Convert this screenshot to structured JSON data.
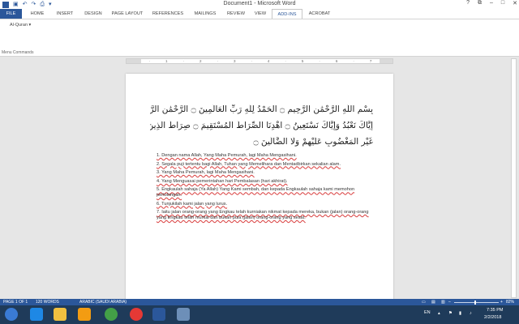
{
  "window": {
    "title": "Document1 - Microsoft Word",
    "qat": {
      "word_logo": "W",
      "save_icon": "floppy-icon",
      "undo_icon": "undo-icon",
      "redo_icon": "redo-icon",
      "print_icon": "print-icon",
      "more_icon": "dropdown-icon"
    },
    "controls": {
      "help": "?",
      "restore": "⧉",
      "minimize": "–",
      "maximize": "□",
      "close": "✕"
    }
  },
  "tabs": [
    {
      "label": "FILE"
    },
    {
      "label": "HOME"
    },
    {
      "label": "INSERT"
    },
    {
      "label": "DESIGN"
    },
    {
      "label": "PAGE LAYOUT"
    },
    {
      "label": "REFERENCES"
    },
    {
      "label": "MAILINGS"
    },
    {
      "label": "REVIEW"
    },
    {
      "label": "VIEW"
    },
    {
      "label": "ADD-INS"
    },
    {
      "label": "ACROBAT"
    }
  ],
  "active_tab": "ADD-INS",
  "ribbon": {
    "button_label": "Al-Quran ▾",
    "group_label": "Menu Commands"
  },
  "ruler": {
    "ticks": [
      "·",
      "1",
      "·",
      "2",
      "·",
      "3",
      "·",
      "4",
      "·",
      "5",
      "·",
      "6",
      "·",
      "7"
    ]
  },
  "document": {
    "arabic_lines": [
      "بِسْمِ اللَّهِ الرَّحْمَٰنِ الرَّحِيمِ ۝ الْحَمْدُ لِلَّهِ رَبِّ الْعَالَمِينَ ۝ الرَّحْمَٰنِ الرَّحِيمِ ۝ مَالِكِ يَوْمِ الدِّينِ",
      "إِيَّاكَ نَعْبُدُ وَإِيَّاكَ نَسْتَعِينُ ۝ اهْدِنَا الصِّرَاطَ الْمُسْتَقِيمَ ۝ صِرَاطَ الَّذِينَ أَنْعَمْتَ عَلَيْهِمْ",
      "غَيْرِ الْمَغْضُوبِ عَلَيْهِمْ وَلَا الضَّالِّينَ ۝"
    ],
    "verses": [
      "1. Dengan nama Allah, Yang Maha Pemurah, lagi Maha Mengasihani.",
      "2. Segala puji tertentu bagi Allah, Tuhan yang Memelihara dan Mentadbirkan sekalian alam.",
      "3. Yang Maha Pemurah, lagi Maha Mengasihani.",
      "4. Yang Menguasai pemerintahan hari Pembalasan (hari akhirat).",
      "5. Engkaulah sahaja (Ya Allah) Yang Kami sembah, dan kepada Engkaulah sahaja kami memohon pertolongan.",
      "6. Tunjukilah kami jalan yang lurus.",
      "7. Iaitu jalan orang-orang yang Engkau telah kurniakan nikmat kepada mereka, bukan (jalan) orang-orang yang Engkau telah murkai dan bukan pula (jalan) orang-orang yang sesat."
    ]
  },
  "statusbar": {
    "page": "PAGE 1 OF 1",
    "words": "120 WORDS",
    "language": "ARABIC (SAUDI ARABIA)",
    "zoom": "82%",
    "zoom_fraction": 0.45
  },
  "taskbar": {
    "icons": [
      {
        "name": "start-icon",
        "color": "#3a7bd5"
      },
      {
        "name": "ie-icon",
        "color": "#1e88e5"
      },
      {
        "name": "explorer-icon",
        "color": "#f0c040"
      },
      {
        "name": "media-player-icon",
        "color": "#f39c12"
      },
      {
        "name": "chrome-icon",
        "color": "#43a047"
      },
      {
        "name": "opera-icon",
        "color": "#e53935"
      },
      {
        "name": "word-taskbar-icon",
        "color": "#2b579a"
      },
      {
        "name": "app-taskbar-icon",
        "color": "#6d8fb8"
      }
    ],
    "lang": "EN",
    "time": "7:35 PM",
    "date": "2/2/2018"
  }
}
